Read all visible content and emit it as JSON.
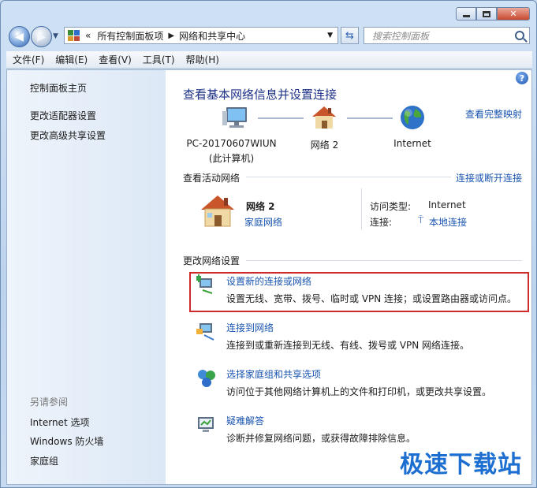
{
  "window": {
    "caption_buttons": [
      "minimize",
      "maximize",
      "close"
    ]
  },
  "address": {
    "overflow": "«",
    "crumbs": [
      "所有控制面板项",
      "网络和共享中心"
    ],
    "search_placeholder": "搜索控制面板"
  },
  "menu": [
    "文件(F)",
    "编辑(E)",
    "查看(V)",
    "工具(T)",
    "帮助(H)"
  ],
  "sidebar": {
    "items": [
      "控制面板主页",
      "更改适配器设置",
      "更改高级共享设置"
    ],
    "see_also_title": "另请参阅",
    "see_also": [
      "Internet 选项",
      "Windows 防火墙",
      "家庭组"
    ]
  },
  "main": {
    "title": "查看基本网络信息并设置连接",
    "view_full_map": "查看完整映射",
    "map": {
      "computer_name": "PC-20170607WIUN",
      "computer_sub": "(此计算机)",
      "network": "网络  2",
      "internet": "Internet"
    },
    "active_header": "查看活动网络",
    "connect_disconnect": "连接或断开连接",
    "active": {
      "name": "网络  2",
      "type_link": "家庭网络",
      "access_label": "访问类型:",
      "access_value": "Internet",
      "conn_label": "连接:",
      "conn_value": "本地连接"
    },
    "change_header": "更改网络设置",
    "tasks": [
      {
        "title": "设置新的连接或网络",
        "desc": "设置无线、宽带、拨号、临时或 VPN 连接；或设置路由器或访问点。"
      },
      {
        "title": "连接到网络",
        "desc": "连接到或重新连接到无线、有线、拨号或 VPN 网络连接。"
      },
      {
        "title": "选择家庭组和共享选项",
        "desc": "访问位于其他网络计算机上的文件和打印机，或更改共享设置。"
      },
      {
        "title": "疑难解答",
        "desc": "诊断并修复网络问题，或获得故障排除信息。"
      }
    ]
  },
  "watermark": "极速下载站",
  "colors": {
    "link": "#1a55b0",
    "title": "#1e3287",
    "highlight": "#cf2b2b"
  }
}
